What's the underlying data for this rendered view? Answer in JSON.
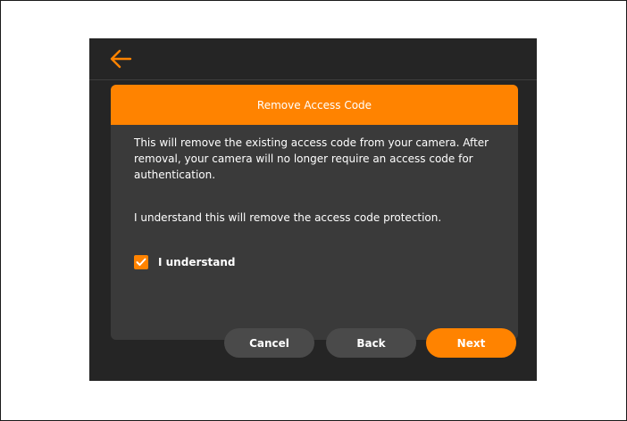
{
  "dialog": {
    "title": "Remove Access Code",
    "warning": "This will remove the existing access code from your camera. After removal, your camera will no longer require an access code for authentication.",
    "confirmation_statement": "I understand this will remove the access code protection.",
    "checkbox": {
      "label": "I understand",
      "checked": true
    }
  },
  "buttons": {
    "cancel": "Cancel",
    "back": "Back",
    "next": "Next"
  },
  "colors": {
    "accent": "#ff8300",
    "background": "#252525",
    "dialog_background": "#3a3a3a",
    "secondary_button": "#4a4a4a"
  },
  "icons": {
    "back": "back-arrow-icon",
    "checkbox": "checkmark-icon"
  }
}
